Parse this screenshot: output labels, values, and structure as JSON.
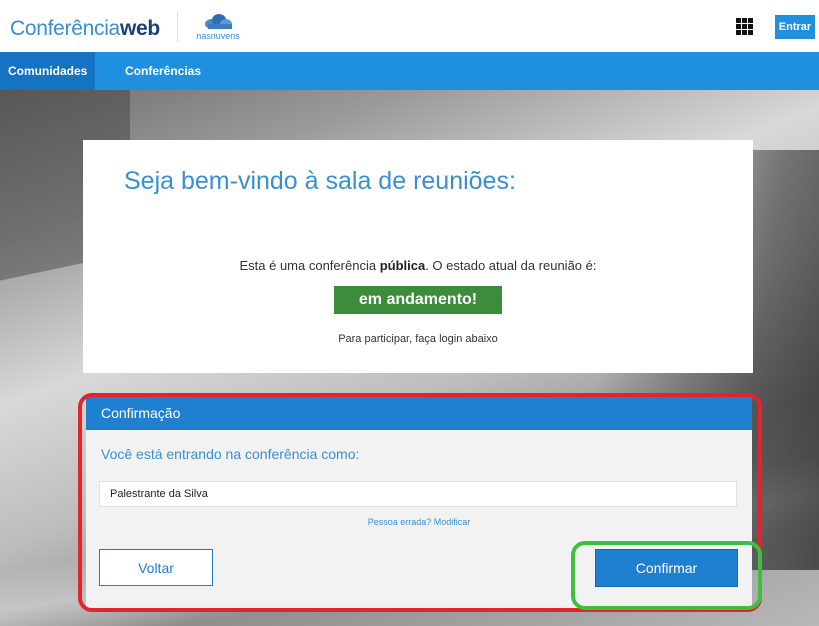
{
  "header": {
    "logo_prefix": "Conferência",
    "logo_bold": "web",
    "partner_text": "nasnuvens",
    "login_label": "Entrar"
  },
  "nav": {
    "items": [
      {
        "label": "Comunidades"
      },
      {
        "label": "Conferências"
      }
    ]
  },
  "welcome": {
    "title": "Seja bem-vindo à sala de reuniões:",
    "info_before": "Esta é uma conferência ",
    "info_bold": "pública",
    "info_after": ". O estado atual da reunião é:",
    "status": "em andamento!",
    "hint": "Para participar, faça login abaixo"
  },
  "confirm": {
    "title": "Confirmação",
    "subtitle": "Você está entrando na conferência como:",
    "name_value": "Palestrante da Silva",
    "change_link": "Pessoa errada? Modificar",
    "back_label": "Voltar",
    "confirm_label": "Confirmar"
  },
  "colors": {
    "primary": "#1f8fe0",
    "panel_header": "#1f7fd1",
    "status_green": "#3b8c3b",
    "annotation_red": "#e3242b",
    "annotation_green": "#3fbf3f"
  },
  "icons": {
    "apps": "apps-grid-icon",
    "partner": "cloud-logo-icon"
  }
}
